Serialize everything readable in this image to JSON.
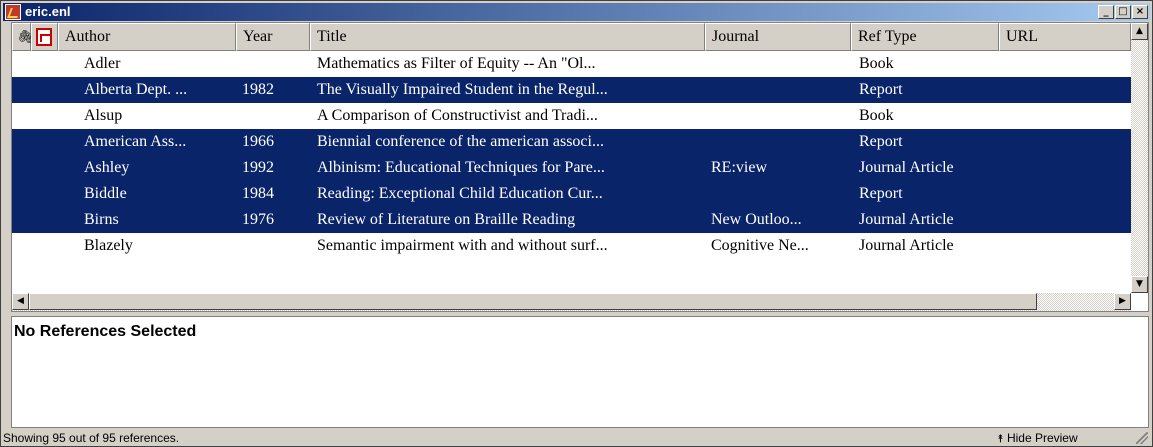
{
  "window": {
    "title": "eric.enl",
    "min_glyph": "_",
    "max_glyph": "□",
    "close_glyph": "×"
  },
  "columns": {
    "attach_icon": "paperclip-icon",
    "pdf_icon": "pdf-icon",
    "author": "Author",
    "year": "Year",
    "title": "Title",
    "journal": "Journal",
    "reftype": "Ref Type",
    "url": "URL"
  },
  "rows": [
    {
      "author": "Adler",
      "year": "",
      "title": "Mathematics as Filter of Equity -- An \"Ol...",
      "journal": "",
      "reftype": "Book",
      "url": "",
      "selected": false
    },
    {
      "author": "Alberta Dept. ...",
      "year": "1982",
      "title": "The Visually Impaired Student in the Regul...",
      "journal": "",
      "reftype": "Report",
      "url": "",
      "selected": true
    },
    {
      "author": "Alsup",
      "year": "",
      "title": "A Comparison of Constructivist and Tradi...",
      "journal": "",
      "reftype": "Book",
      "url": "",
      "selected": false
    },
    {
      "author": "American Ass...",
      "year": "1966",
      "title": "Biennial conference of the american associ...",
      "journal": "",
      "reftype": "Report",
      "url": "",
      "selected": true
    },
    {
      "author": "Ashley",
      "year": "1992",
      "title": "Albinism: Educational Techniques for Pare...",
      "journal": "RE:view",
      "reftype": "Journal Article",
      "url": "",
      "selected": true
    },
    {
      "author": "Biddle",
      "year": "1984",
      "title": "Reading: Exceptional Child Education Cur...",
      "journal": "",
      "reftype": "Report",
      "url": "",
      "selected": true
    },
    {
      "author": "Birns",
      "year": "1976",
      "title": "Review of Literature on Braille Reading",
      "journal": "New Outloo...",
      "reftype": "Journal Article",
      "url": "",
      "selected": true
    },
    {
      "author": "Blazely",
      "year": "",
      "title": "Semantic impairment with and without surf...",
      "journal": "Cognitive Ne...",
      "reftype": "Journal Article",
      "url": "",
      "selected": false
    }
  ],
  "preview": {
    "text": "No References Selected"
  },
  "status": {
    "text": "Showing 95 out of 95 references.",
    "hide_preview_label": "Hide Preview",
    "hide_preview_icon": "up-arrow-icon"
  },
  "colors": {
    "selection": "#0a246a",
    "titlebar_start": "#0a246a",
    "titlebar_end": "#a6caf0",
    "chrome": "#d4d0c8"
  }
}
